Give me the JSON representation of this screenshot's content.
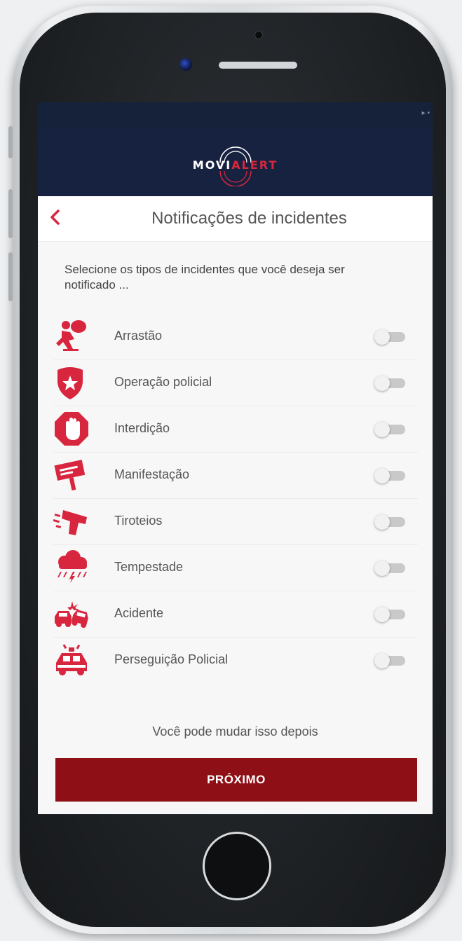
{
  "brand": {
    "part1": "MOVI",
    "part2": "ALERT",
    "accent_color": "#d8263f",
    "header_bg": "#172240"
  },
  "titlebar": {
    "back_icon": "chevron-left-icon",
    "title": "Notificações de incidentes"
  },
  "intro": "Selecione os tipos de incidentes que você deseja ser notificado ...",
  "incidents": [
    {
      "label": "Arrastão",
      "icon": "running-thief-icon",
      "enabled": false
    },
    {
      "label": "Operação policial",
      "icon": "police-badge-icon",
      "enabled": false
    },
    {
      "label": "Interdição",
      "icon": "stop-hand-icon",
      "enabled": false
    },
    {
      "label": "Manifestação",
      "icon": "protest-sign-icon",
      "enabled": false
    },
    {
      "label": "Tiroteios",
      "icon": "gun-icon",
      "enabled": false
    },
    {
      "label": "Tempestade",
      "icon": "storm-cloud-icon",
      "enabled": false
    },
    {
      "label": "Acidente",
      "icon": "car-crash-icon",
      "enabled": false
    },
    {
      "label": "Perseguição Policial",
      "icon": "police-car-icon",
      "enabled": false
    }
  ],
  "hint": "Você pode mudar isso depois",
  "next_button": {
    "label": "PRÓXIMO",
    "color": "#8e1016"
  }
}
